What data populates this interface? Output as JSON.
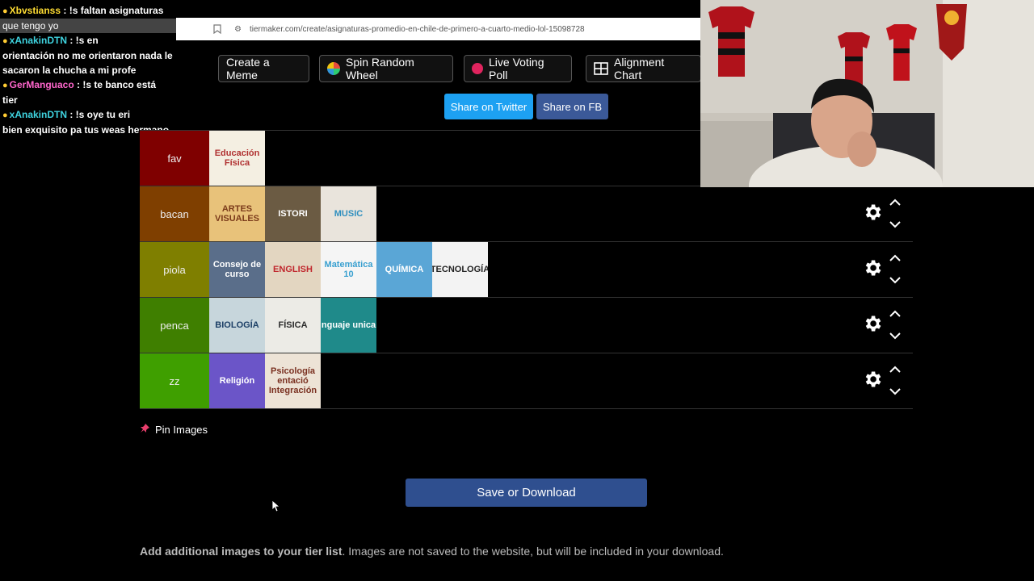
{
  "browser": {
    "url": "tiermaker.com/create/asignaturas-promedio-en-chile-de-primero-a-cuarto-medio-lol-15098728"
  },
  "chat": [
    {
      "user": "Xbvstianss",
      "user_color": "#ffdd33",
      "text": ": !s faltan asignaturas",
      "text2": "que tengo yo"
    },
    {
      "user": "xAnakinDTN",
      "user_color": "#3fd4e0",
      "text": ": !s en",
      "text2": "orientación no me orientaron nada le sacaron la chucha a mi profe"
    },
    {
      "user": "GerManguaco",
      "user_color": "#ff66cc",
      "text": ": !s te banco está tier",
      "text2": ""
    },
    {
      "user": "xAnakinDTN",
      "user_color": "#3fd4e0",
      "text": ": !s oye tu eri",
      "text2": "bien exquisito pa tus weas hermano"
    }
  ],
  "top_buttons": {
    "meme": "Create a Meme",
    "wheel": "Spin Random Wheel",
    "poll": "Live Voting Poll",
    "chart": "Alignment Chart"
  },
  "share": {
    "twitter": "Share on Twitter",
    "fb": "Share on FB"
  },
  "tiers": [
    {
      "label": "fav",
      "color": "#7f0000",
      "items": [
        {
          "text": "Educación Física",
          "bg": "#f4efe2",
          "fg": "#b03030"
        }
      ]
    },
    {
      "label": "bacan",
      "color": "#7f3f00",
      "items": [
        {
          "text": "ARTES VISUALES",
          "bg": "#e8c27a",
          "fg": "#7a3a1a"
        },
        {
          "text": "ISTORI",
          "bg": "#6b5b43",
          "fg": "#ffffff"
        },
        {
          "text": "MUSIC",
          "bg": "#e9e4dc",
          "fg": "#2f8fbf"
        }
      ]
    },
    {
      "label": "piola",
      "color": "#7f7f00",
      "items": [
        {
          "text": "Consejo de curso",
          "bg": "#5a6e8a",
          "fg": "#ffffff"
        },
        {
          "text": "ENGLISH",
          "bg": "#e3d6c1",
          "fg": "#c0262c"
        },
        {
          "text": "Matemática 10",
          "bg": "#f5f5f5",
          "fg": "#3aa0d0"
        },
        {
          "text": "QUÍMICA",
          "bg": "#5aa6d6",
          "fg": "#ffffff"
        },
        {
          "text": "TECNOLOGÍA",
          "bg": "#f3f3f3",
          "fg": "#222222"
        }
      ]
    },
    {
      "label": "penca",
      "color": "#3f7f00",
      "items": [
        {
          "text": "BIOLOGÍA",
          "bg": "#c7d6dc",
          "fg": "#1c3f66"
        },
        {
          "text": "FÍSICA",
          "bg": "#ecebe6",
          "fg": "#2b2b2b"
        },
        {
          "text": "nguaje unica",
          "bg": "#1f8a8a",
          "fg": "#ffffff"
        }
      ]
    },
    {
      "label": "zz",
      "color": "#3f9f00",
      "items": [
        {
          "text": "Religión",
          "bg": "#6b55c8",
          "fg": "#ffffff"
        },
        {
          "text": "Psicología entació Integración",
          "bg": "#ede3d6",
          "fg": "#7a3020"
        }
      ]
    }
  ],
  "pin_label": "Pin Images",
  "save_label": "Save or Download",
  "footer": {
    "bold": "Add additional images to your tier list",
    "rest": ". Images are not saved to the website, but will be included in your download."
  }
}
